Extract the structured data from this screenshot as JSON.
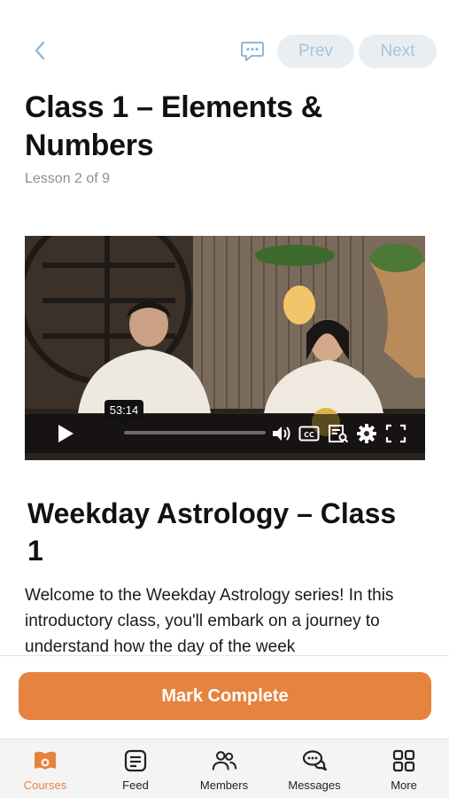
{
  "header": {
    "back_icon": "chevron-left-icon",
    "chat_icon": "chat-bubble-icon",
    "prev_label": "Prev",
    "next_label": "Next"
  },
  "lesson": {
    "title": "Class 1 – Elements & Numbers",
    "subtitle": "Lesson 2 of 9"
  },
  "video": {
    "time_tooltip": "53:14",
    "controls": [
      "play-icon",
      "volume-icon",
      "captions-icon",
      "transcript-icon",
      "settings-icon",
      "fullscreen-icon"
    ]
  },
  "content": {
    "section_title": "Weekday Astrology – Class 1",
    "description": "Welcome to the Weekday Astrology series! In this introductory class, you'll embark on a journey to understand how the day of the week"
  },
  "actions": {
    "mark_complete_label": "Mark Complete"
  },
  "tabbar": {
    "items": [
      {
        "label": "Courses",
        "icon": "courses-icon",
        "active": true
      },
      {
        "label": "Feed",
        "icon": "feed-icon",
        "active": false
      },
      {
        "label": "Members",
        "icon": "members-icon",
        "active": false
      },
      {
        "label": "Messages",
        "icon": "messages-icon",
        "active": false
      },
      {
        "label": "More",
        "icon": "grid-icon",
        "active": false
      }
    ]
  },
  "colors": {
    "accent": "#e5833f",
    "link": "#8fb6d6",
    "pill_bg": "#e9eef3",
    "pill_text": "#a9c4da"
  }
}
